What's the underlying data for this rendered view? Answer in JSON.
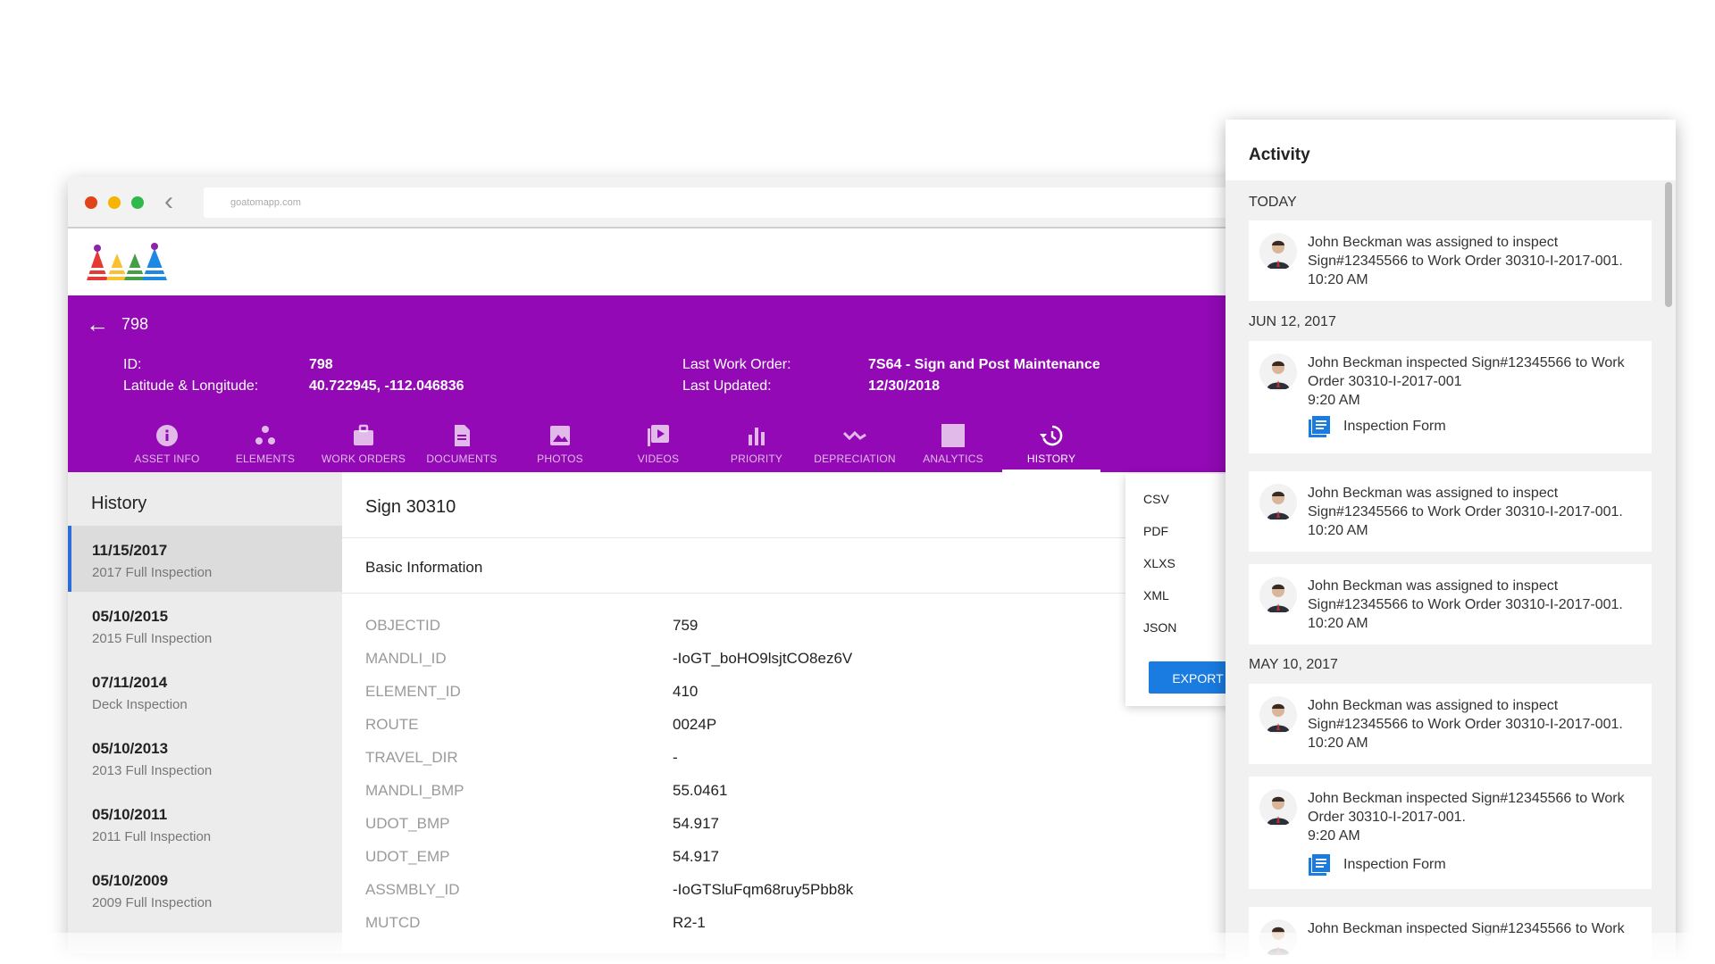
{
  "browser": {
    "url": "goatomapp.com"
  },
  "header": {
    "title": "798",
    "meta": {
      "id_label": "ID:",
      "id_value": "798",
      "latlng_label": "Latitude & Longitude:",
      "latlng_value": "40.722945, -112.046836",
      "workorder_label": "Last Work Order:",
      "workorder_value": "7S64 - Sign and Post Maintenance",
      "updated_label": "Last Updated:",
      "updated_value": "12/30/2018"
    },
    "tabs": [
      {
        "label": "ASSET INFO",
        "icon": "info-icon"
      },
      {
        "label": "ELEMENTS",
        "icon": "elements-icon"
      },
      {
        "label": "WORK ORDERS",
        "icon": "briefcase-icon"
      },
      {
        "label": "DOCUMENTS",
        "icon": "document-icon"
      },
      {
        "label": "PHOTOS",
        "icon": "photo-icon"
      },
      {
        "label": "VIDEOS",
        "icon": "video-icon"
      },
      {
        "label": "PRIORITY",
        "icon": "bar-chart-icon"
      },
      {
        "label": "DEPRECIATION",
        "icon": "trend-icon"
      },
      {
        "label": "ANALYTICS",
        "icon": "analytics-icon"
      },
      {
        "label": "HISTORY",
        "icon": "history-icon",
        "active": true
      }
    ]
  },
  "sidebar": {
    "title": "History",
    "items": [
      {
        "date": "11/15/2017",
        "sub": "2017 Full Inspection",
        "active": true
      },
      {
        "date": "05/10/2015",
        "sub": "2015 Full Inspection"
      },
      {
        "date": "07/11/2014",
        "sub": "Deck Inspection"
      },
      {
        "date": "05/10/2013",
        "sub": "2013 Full Inspection"
      },
      {
        "date": "05/10/2011",
        "sub": "2011 Full Inspection"
      },
      {
        "date": "05/10/2009",
        "sub": "2009 Full Inspection"
      }
    ]
  },
  "detail": {
    "title": "Sign 30310",
    "section": "Basic Information",
    "rows": [
      {
        "key": "OBJECTID",
        "value": "759"
      },
      {
        "key": "MANDLI_ID",
        "value": "-IoGT_boHO9lsjtCO8ez6V"
      },
      {
        "key": "ELEMENT_ID",
        "value": "410"
      },
      {
        "key": "ROUTE",
        "value": "0024P"
      },
      {
        "key": "TRAVEL_DIR",
        "value": "-"
      },
      {
        "key": "MANDLI_BMP",
        "value": "55.0461"
      },
      {
        "key": "UDOT_BMP",
        "value": "54.917"
      },
      {
        "key": "UDOT_EMP",
        "value": "54.917"
      },
      {
        "key": "ASSMBLY_ID",
        "value": "-IoGTSluFqm68ruy5Pbb8k"
      },
      {
        "key": "MUTCD",
        "value": "R2-1"
      }
    ]
  },
  "export": {
    "options": [
      "CSV",
      "PDF",
      "XLXS",
      "XML",
      "JSON"
    ],
    "button": "EXPORT"
  },
  "activity": {
    "title": "Activity",
    "groups": [
      {
        "label": "TODAY"
      },
      {
        "label": "JUN 12, 2017"
      },
      {
        "label": "MAY 10, 2017"
      }
    ],
    "cards": [
      {
        "text": "John Beckman was assigned to inspect Sign#12345566 to Work Order 30310-I-2017-001.",
        "time": "10:20 AM"
      },
      {
        "text": "John Beckman inspected Sign#12345566 to Work Order 30310-I-2017-001",
        "time": "9:20 AM",
        "link": "Inspection Form"
      },
      {
        "text": "John Beckman was assigned to inspect Sign#12345566 to Work Order 30310-I-2017-001.",
        "time": "10:20 AM"
      },
      {
        "text": "John Beckman was assigned to inspect Sign#12345566 to Work Order 30310-I-2017-001.",
        "time": "10:20 AM"
      },
      {
        "text": "John Beckman was assigned to inspect Sign#12345566 to Work Order 30310-I-2017-001.",
        "time": "10:20 AM"
      },
      {
        "text": "John Beckman inspected Sign#12345566 to Work Order 30310-I-2017-001.",
        "time": "9:20 AM",
        "link": "Inspection Form"
      },
      {
        "text": "John Beckman inspected Sign#12345566 to Work",
        "time": ""
      }
    ]
  },
  "colors": {
    "brand_purple": "#9209b5",
    "accent_blue": "#1a7be0"
  }
}
